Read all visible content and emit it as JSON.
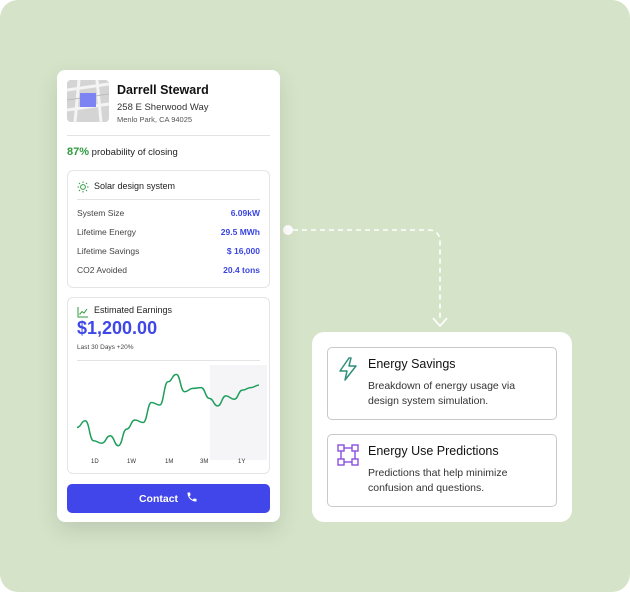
{
  "lead": {
    "name": "Darrell Steward",
    "address_line1": "258 E Sherwood Way",
    "address_line2": "Menlo Park, CA 94025",
    "probability_pct": "87%",
    "probability_text": "probability of closing"
  },
  "solar": {
    "title": "Solar design system",
    "rows": [
      {
        "label": "System Size",
        "value": "6.09kW"
      },
      {
        "label": "Lifetime Energy",
        "value": "29.5 MWh"
      },
      {
        "label": "Lifetime Savings",
        "value": "$ 16,000"
      },
      {
        "label": "CO2 Avoided",
        "value": "20.4 tons"
      }
    ]
  },
  "earnings": {
    "title": "Estimated Earnings",
    "amount": "$1,200.00",
    "subtitle": "Last 30 Days +20%",
    "ranges": [
      "1D",
      "1W",
      "1M",
      "3M",
      "1Y"
    ]
  },
  "chart_data": {
    "type": "line",
    "x": [
      0,
      1,
      2,
      3,
      4,
      5,
      6,
      7,
      8,
      9,
      10,
      11,
      12,
      13,
      14,
      15,
      16,
      17,
      18,
      19,
      20,
      21,
      22
    ],
    "series": [
      {
        "values": [
          3.2,
          4.0,
          1.6,
          1.3,
          2.2,
          1.0,
          3.0,
          4.1,
          3.8,
          6.2,
          5.9,
          8.7,
          9.6,
          7.5,
          7.9,
          8.0,
          6.7,
          5.8,
          7.0,
          6.6,
          7.7,
          8.0,
          8.3
        ]
      }
    ],
    "xlabel": "",
    "ylabel": "",
    "ylim": [
      0,
      10
    ],
    "grid": false,
    "color": "#1f9e5c"
  },
  "contact": {
    "label": "Contact"
  },
  "features": [
    {
      "title": "Energy Savings",
      "desc": "Breakdown of energy usage via design system simulation.",
      "icon": "lightning-icon"
    },
    {
      "title": "Energy Use Predictions",
      "desc": "Predictions that help minimize confusion and questions.",
      "icon": "vector-square-icon"
    }
  ],
  "colors": {
    "background": "#d5e4c9",
    "accent": "#4046ea",
    "green": "#2f9b3f",
    "feature_icon": "#8a4fe0"
  }
}
